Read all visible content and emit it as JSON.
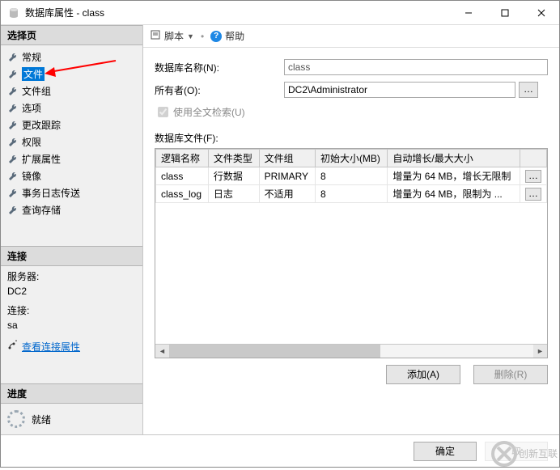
{
  "window": {
    "title": "数据库属性 - class"
  },
  "sidebar": {
    "section_select": "选择页",
    "items": [
      {
        "label": "常规"
      },
      {
        "label": "文件"
      },
      {
        "label": "文件组"
      },
      {
        "label": "选项"
      },
      {
        "label": "更改跟踪"
      },
      {
        "label": "权限"
      },
      {
        "label": "扩展属性"
      },
      {
        "label": "镜像"
      },
      {
        "label": "事务日志传送"
      },
      {
        "label": "查询存储"
      }
    ],
    "section_conn": "连接",
    "conn": {
      "server_label": "服务器:",
      "server_value": "DC2",
      "connection_label": "连接:",
      "connection_value": "sa",
      "view_props": "查看连接属性"
    },
    "section_progress": "进度",
    "progress_text": "就绪"
  },
  "toolbar": {
    "script": "脚本",
    "help": "帮助"
  },
  "form": {
    "db_name_label": "数据库名称(N):",
    "db_name_value": "class",
    "owner_label": "所有者(O):",
    "owner_value": "DC2\\Administrator",
    "fulltext_label": "使用全文检索(U)",
    "files_label": "数据库文件(F):"
  },
  "grid": {
    "cols": [
      "逻辑名称",
      "文件类型",
      "文件组",
      "初始大小(MB)",
      "自动增长/最大大小"
    ],
    "rows": [
      {
        "name": "class",
        "ftype": "行数据",
        "fgroup": "PRIMARY",
        "size": "8",
        "growth": "增量为 64 MB，增长无限制"
      },
      {
        "name": "class_log",
        "ftype": "日志",
        "fgroup": "不适用",
        "size": "8",
        "growth": "增量为 64 MB，限制为 ..."
      }
    ]
  },
  "buttons": {
    "add": "添加(A)",
    "remove": "删除(R)",
    "ok": "确定",
    "cancel": "取"
  },
  "watermark": "创新互联"
}
